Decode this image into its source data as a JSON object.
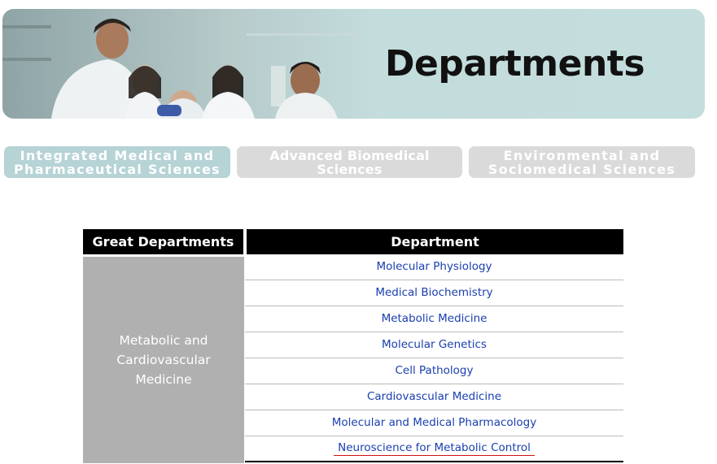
{
  "banner": {
    "title": "Departments"
  },
  "tabs": [
    {
      "label": "Integrated Medical and\nPharmaceutical Sciences",
      "selected": true
    },
    {
      "label": "Advanced Biomedical Sciences",
      "selected": false
    },
    {
      "label": "Environmental and\nSociomedical Sciences",
      "selected": false
    }
  ],
  "table": {
    "headers": {
      "great": "Great Departments",
      "department": "Department"
    },
    "great_department": "Metabolic and Cardiovascular Medicine",
    "departments": [
      "Molecular Physiology",
      "Medical Biochemistry",
      "Metabolic Medicine",
      "Molecular Genetics",
      "Cell Pathology",
      "Cardiovascular Medicine",
      "Molecular and Medical Pharmacology",
      "Neuroscience for Metabolic Control"
    ]
  },
  "colors": {
    "link": "#1a3fb0",
    "tab_selected": "#b6d3d6",
    "tab_inactive": "#dadada",
    "great_cell": "#b0b0b0",
    "header": "#000000"
  }
}
